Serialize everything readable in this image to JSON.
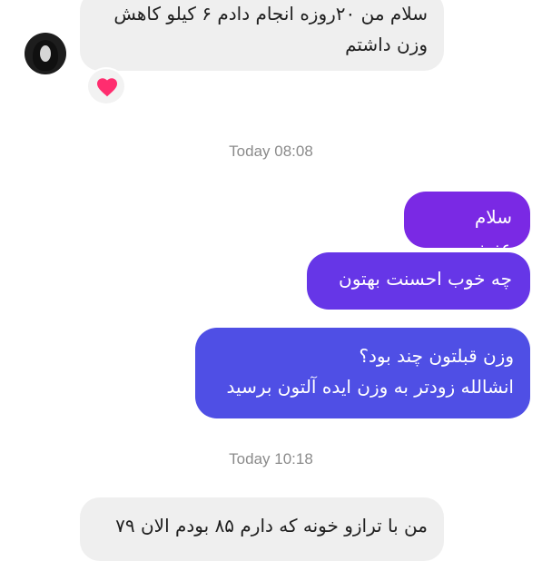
{
  "conversation": {
    "messages": [
      {
        "text": "سلام من ۲۰روزه انجام دادم ۶ کیلو کاهش\nوزن داشتم",
        "direction": "incoming"
      },
      {
        "text": "سلام عزیزم",
        "direction": "outgoing"
      },
      {
        "text": "چه خوب احسنت بهتون",
        "direction": "outgoing"
      },
      {
        "text": "وزن قبلتون چند بود؟\nانشالله زودتر به وزن ایده آلتون برسید",
        "direction": "outgoing"
      },
      {
        "text": "من با ترازو خونه که دارم ۸۵ بودم الان ۷۹",
        "direction": "incoming"
      }
    ],
    "timestamps": [
      "Today 08:08",
      "Today 10:18"
    ],
    "reaction": {
      "icon": "heart-icon",
      "color": "#ff2d6f"
    },
    "colors": {
      "incoming_bg": "#efefef",
      "outgoing_1": "#7a29e4",
      "outgoing_2": "#6636e7",
      "outgoing_3": "#4f4fe5",
      "timestamp": "#8b8b8b"
    }
  }
}
